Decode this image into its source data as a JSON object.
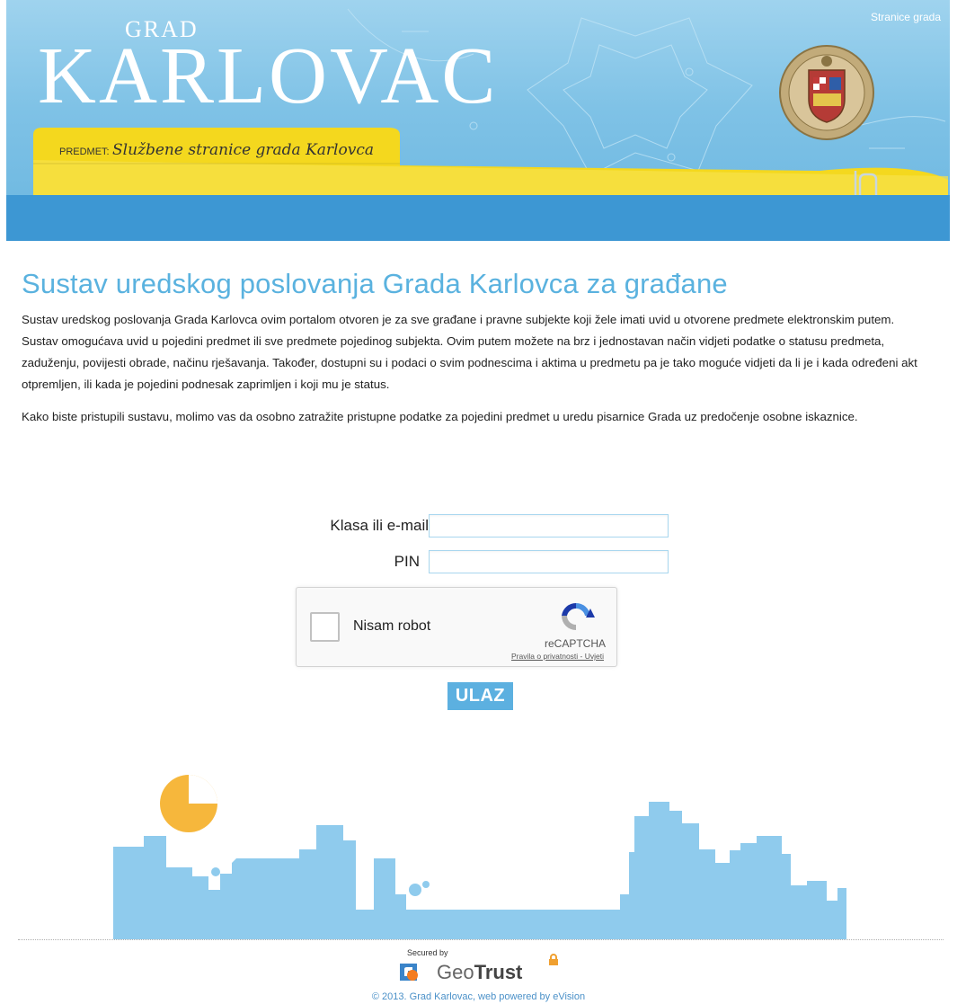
{
  "header": {
    "grad": "GRAD",
    "city": "KARLOVAC",
    "top_link": "Stranice grada",
    "predmet_label": "PREDMET:",
    "predmet_value": "Službene stranice grada Karlovca"
  },
  "main": {
    "title": "Sustav uredskog poslovanja Grada Karlovca za građane",
    "paragraph1": "Sustav uredskog poslovanja Grada Karlovca ovim portalom otvoren je za sve građane i pravne subjekte koji žele imati uvid u otvorene predmete elektronskim putem. Sustav omogućava uvid u pojedini predmet ili sve predmete pojedinog subjekta. Ovim putem možete na brz i jednostavan način vidjeti podatke o statusu predmeta, zaduženju, povijesti obrade, načinu rješavanja. Također, dostupni su i podaci o svim podnescima i aktima u predmetu pa je tako moguće vidjeti da li je i kada određeni akt otpremljen, ili kada je pojedini podnesak zaprimljen i koji mu je status.",
    "paragraph2": "Kako biste pristupili sustavu, molimo vas da osobno zatražite pristupne podatke za pojedini predmet u uredu pisarnice Grada uz predočenje osobne iskaznice."
  },
  "form": {
    "klasa_label": "Klasa ili e-mail",
    "klasa_value": "",
    "pin_label": "PIN",
    "pin_value": "",
    "submit_label": "ULAZ"
  },
  "captcha": {
    "label": "Nisam robot",
    "brand": "reCAPTCHA",
    "terms": "Pravila o privatnosti - Uvjeti"
  },
  "footer": {
    "secured_by": "Secured by",
    "geotrust_light": "Geo",
    "geotrust_bold": "Trust",
    "copyright": "© 2013. Grad Karlovac, web powered by eVision"
  },
  "colors": {
    "accent": "#5ab2df",
    "header_band": "#3d97d3",
    "skyline": "#8fcbed",
    "sun": "#f6b73c",
    "folder": "#f4d81e"
  }
}
